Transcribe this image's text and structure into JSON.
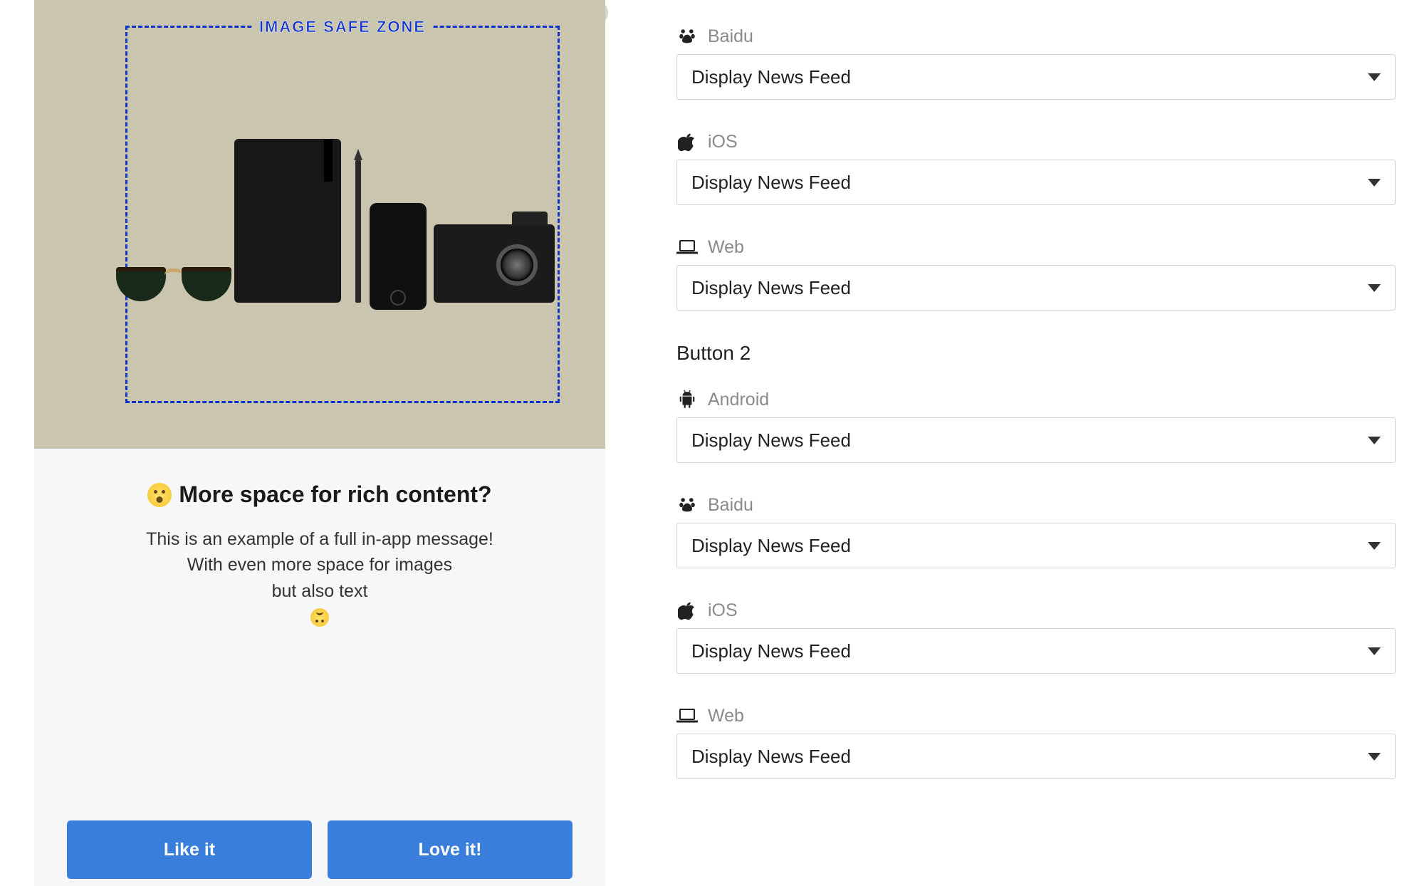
{
  "preview": {
    "safe_zone_label": "IMAGE SAFE ZONE",
    "headline": "More space for rich content?",
    "body_line1": "This is an example of a full in-app message!",
    "body_line2": "With even more space for images",
    "body_line3": "but also text",
    "button1_label": "Like it",
    "button2_label": "Love it!"
  },
  "form": {
    "group1": {
      "items": [
        {
          "icon": "baidu",
          "label": "Baidu",
          "selected": "Display News Feed"
        },
        {
          "icon": "ios",
          "label": "iOS",
          "selected": "Display News Feed"
        },
        {
          "icon": "web",
          "label": "Web",
          "selected": "Display News Feed"
        }
      ]
    },
    "section2_heading": "Button 2",
    "group2": {
      "items": [
        {
          "icon": "android",
          "label": "Android",
          "selected": "Display News Feed"
        },
        {
          "icon": "baidu",
          "label": "Baidu",
          "selected": "Display News Feed"
        },
        {
          "icon": "ios",
          "label": "iOS",
          "selected": "Display News Feed"
        },
        {
          "icon": "web",
          "label": "Web",
          "selected": "Display News Feed"
        }
      ]
    }
  }
}
